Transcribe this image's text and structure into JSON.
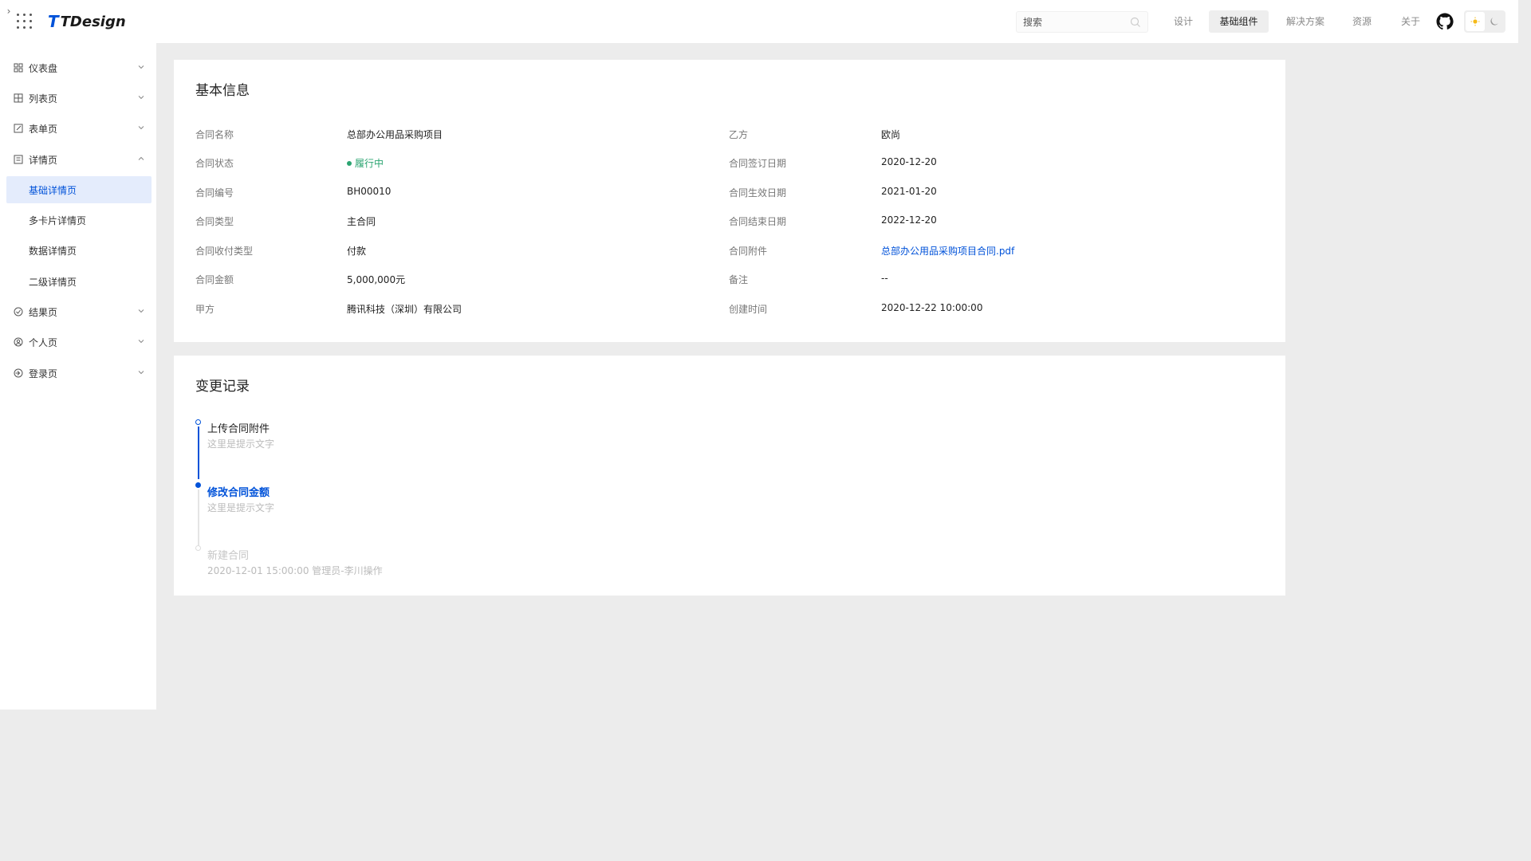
{
  "header": {
    "logo_text": "TDesign",
    "search_placeholder": "搜索",
    "nav": [
      "设计",
      "基础组件",
      "解决方案",
      "资源",
      "关于"
    ],
    "active_nav": "基础组件"
  },
  "sidebar": {
    "items": [
      {
        "label": "仪表盘",
        "icon": "dashboard-icon",
        "expanded": false
      },
      {
        "label": "列表页",
        "icon": "list-icon",
        "expanded": false
      },
      {
        "label": "表单页",
        "icon": "form-icon",
        "expanded": false
      },
      {
        "label": "详情页",
        "icon": "detail-icon",
        "expanded": true
      },
      {
        "label": "结果页",
        "icon": "result-icon",
        "expanded": false
      },
      {
        "label": "个人页",
        "icon": "user-icon",
        "expanded": false
      },
      {
        "label": "登录页",
        "icon": "login-icon",
        "expanded": false
      }
    ],
    "sub_items": [
      "基础详情页",
      "多卡片详情页",
      "数据详情页",
      "二级详情页"
    ],
    "active_sub": "基础详情页"
  },
  "basic_info": {
    "title": "基本信息",
    "fields": [
      {
        "label": "合同名称",
        "value": "总部办公用品采购项目"
      },
      {
        "label": "乙方",
        "value": "欧尚"
      },
      {
        "label": "合同状态",
        "value": "履行中"
      },
      {
        "label": "合同签订日期",
        "value": "2020-12-20"
      },
      {
        "label": "合同编号",
        "value": "BH00010"
      },
      {
        "label": "合同生效日期",
        "value": "2021-01-20"
      },
      {
        "label": "合同类型",
        "value": "主合同"
      },
      {
        "label": "合同结束日期",
        "value": "2022-12-20"
      },
      {
        "label": "合同收付类型",
        "value": "付款"
      },
      {
        "label": "合同附件",
        "value": "总部办公用品采购项目合同.pdf"
      },
      {
        "label": "合同金额",
        "value": "5,000,000元"
      },
      {
        "label": "备注",
        "value": "--"
      },
      {
        "label": "甲方",
        "value": "腾讯科技（深圳）有限公司"
      },
      {
        "label": "创建时间",
        "value": "2020-12-22 10:00:00"
      }
    ]
  },
  "change_log": {
    "title": "变更记录",
    "entries": [
      {
        "title": "上传合同附件",
        "desc": "这里是提示文字"
      },
      {
        "title": "修改合同金额",
        "desc": "这里是提示文字"
      },
      {
        "title": "新建合同",
        "desc": "2020-12-01 15:00:00 管理员-李川操作"
      }
    ]
  },
  "colors": {
    "brand": "#0052d9",
    "success": "#2ba471",
    "active_bg": "#e4ecfc"
  }
}
